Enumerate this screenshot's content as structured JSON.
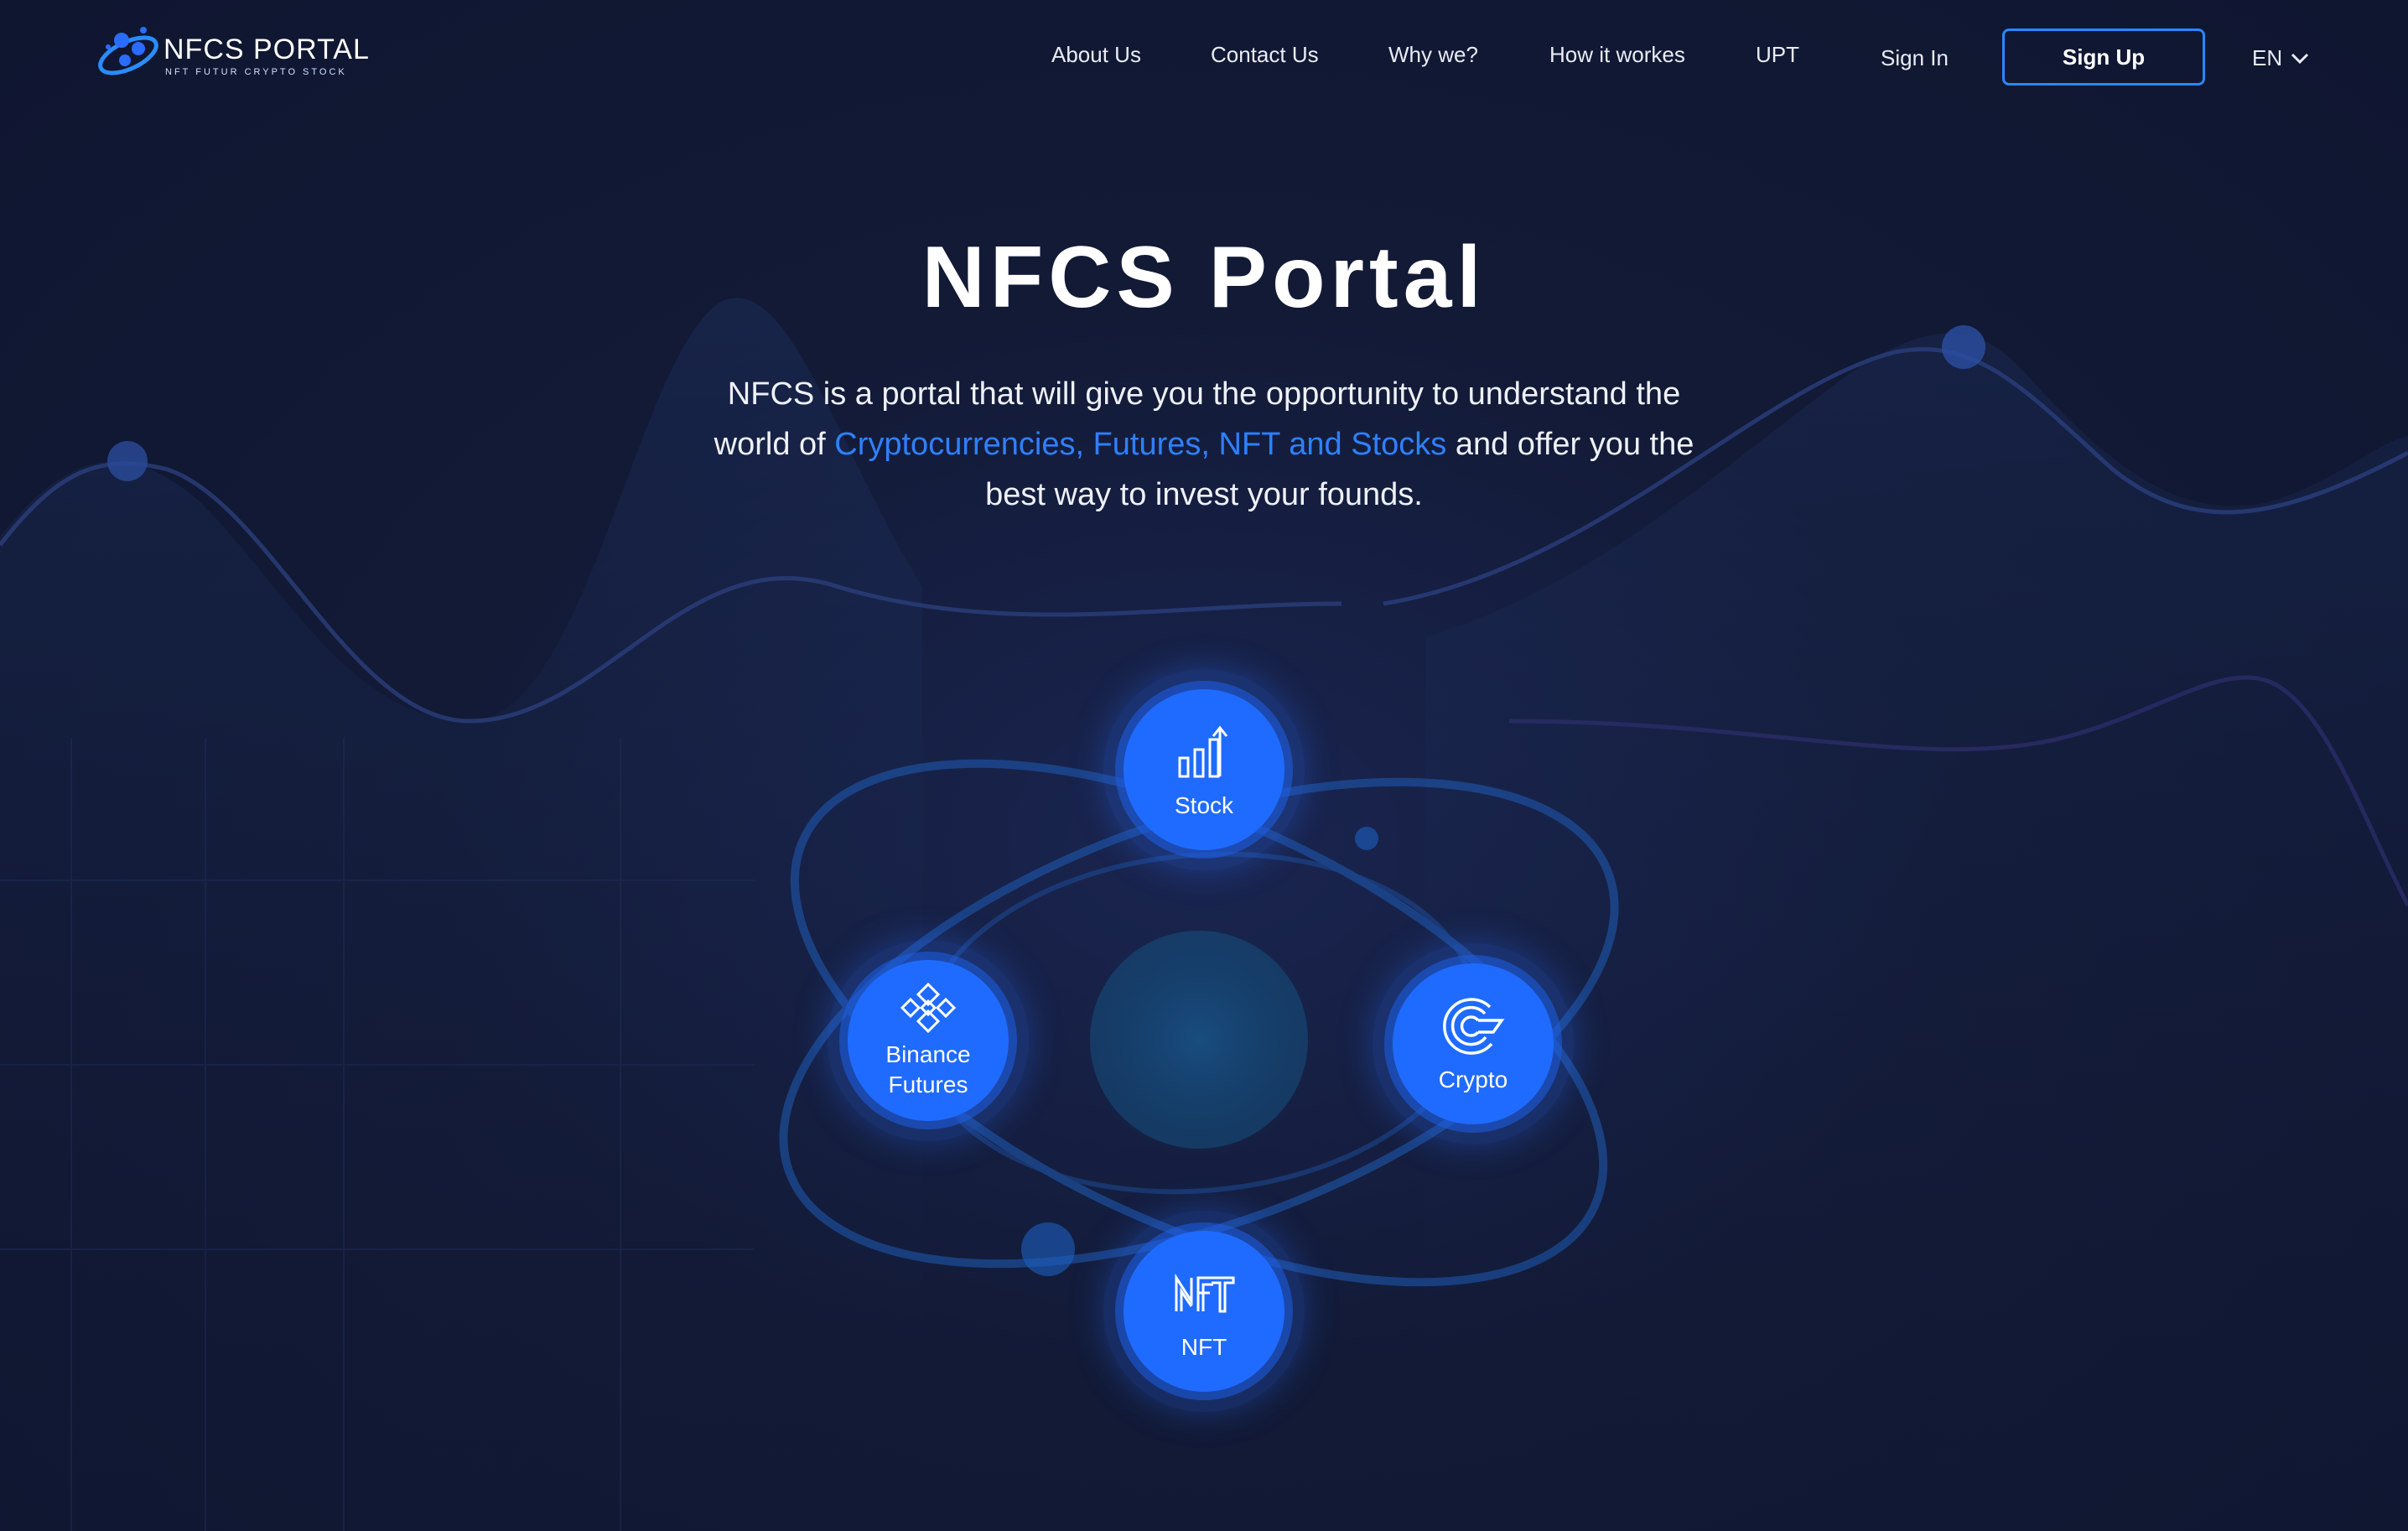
{
  "brand": {
    "name": "NFCS PORTAL",
    "tagline": "NFT FUTUR CRYPTO STOCK"
  },
  "nav": {
    "about": "About Us",
    "contact": "Contact Us",
    "why": "Why we?",
    "how": "How it workes",
    "upt": "UPT",
    "signin": "Sign In",
    "signup": "Sign Up",
    "lang": "EN"
  },
  "hero": {
    "title": "NFCS Portal",
    "desc_part1": "NFCS is a portal that will give you the opportunity to understand the world of ",
    "desc_highlight": "Cryptocurrencies, Futures, NFT and Stocks",
    "desc_part2": " and offer you the best way to invest your founds."
  },
  "nodes": {
    "stock": {
      "label": "Stock",
      "icon": "stock-chart-icon"
    },
    "binance": {
      "label_line1": "Binance",
      "label_line2": "Futures",
      "icon": "binance-icon"
    },
    "crypto": {
      "label": "Crypto",
      "icon": "crypto-coin-icon"
    },
    "nft": {
      "label": "NFT",
      "icon": "nft-icon"
    }
  },
  "colors": {
    "accent": "#1f6bff",
    "link": "#2f80ff",
    "background": "#121a36"
  }
}
